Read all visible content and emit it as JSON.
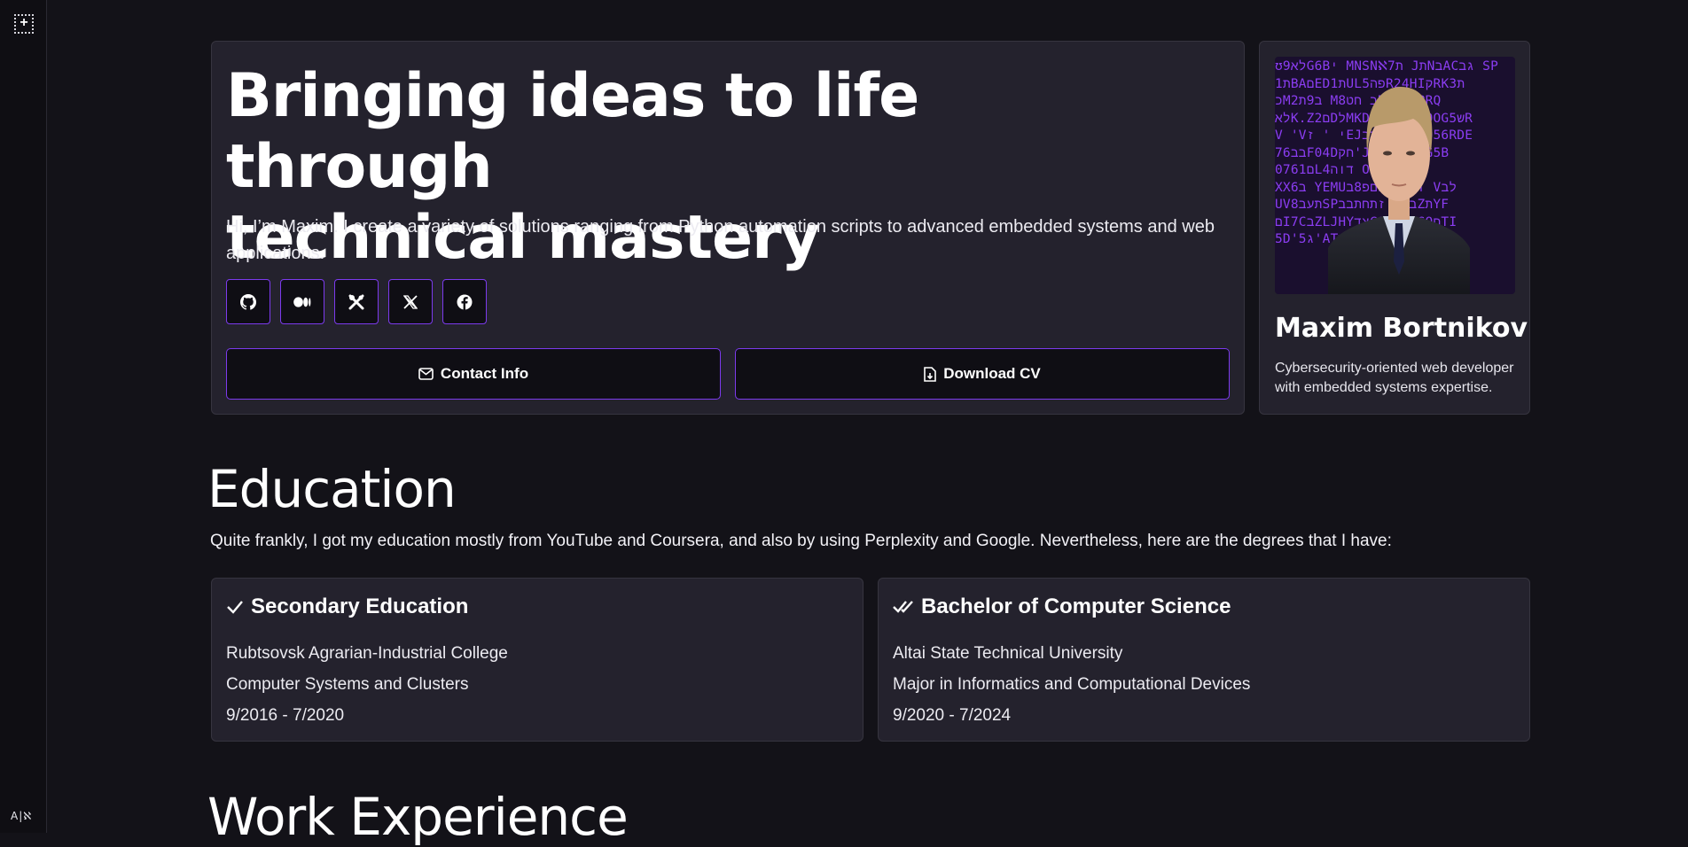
{
  "rail": {
    "expand_glyph": "+",
    "language_label": "A|ℵ"
  },
  "hero": {
    "headline_line1": "Bringing ideas to life through",
    "headline_line2": "technical mastery",
    "intro_line1": "Hi, I’m Maxim. I create a variety of solutions ranging from Python automation scripts to advanced embedded systems and web",
    "intro_line2": "applications.",
    "socials": [
      {
        "icon": "github-icon"
      },
      {
        "icon": "medium-icon"
      },
      {
        "icon": "tools-icon"
      },
      {
        "icon": "x-icon"
      },
      {
        "icon": "facebook-icon"
      }
    ],
    "contact_label": "Contact Info",
    "download_label": "Download CV"
  },
  "profile": {
    "name": "Maxim Bortnikov",
    "bio": "Cybersecurity-oriented web developer with embedded systems expertise."
  },
  "education": {
    "title": "Education",
    "description": "Quite frankly, I got my education mostly from YouTube and Coursera, and also by using Perplexity and Google. Nevertheless, here are the degrees that I have:",
    "degrees": [
      {
        "title": "Secondary Education",
        "institution": "Rubtsovsk Agrarian-Industrial College",
        "field": "Computer Systems and Clusters",
        "dates": "9/2016 - 7/2020"
      },
      {
        "title": "Bachelor of Computer Science",
        "institution": "Altai State Technical University",
        "field": "Major in Informatics and Computational Devices",
        "dates": "9/2020 - 7/2024"
      }
    ]
  },
  "work": {
    "title": "Work Experience"
  },
  "colors": {
    "accent": "#7c3aed",
    "card": "#24222d",
    "background": "#131218"
  }
}
